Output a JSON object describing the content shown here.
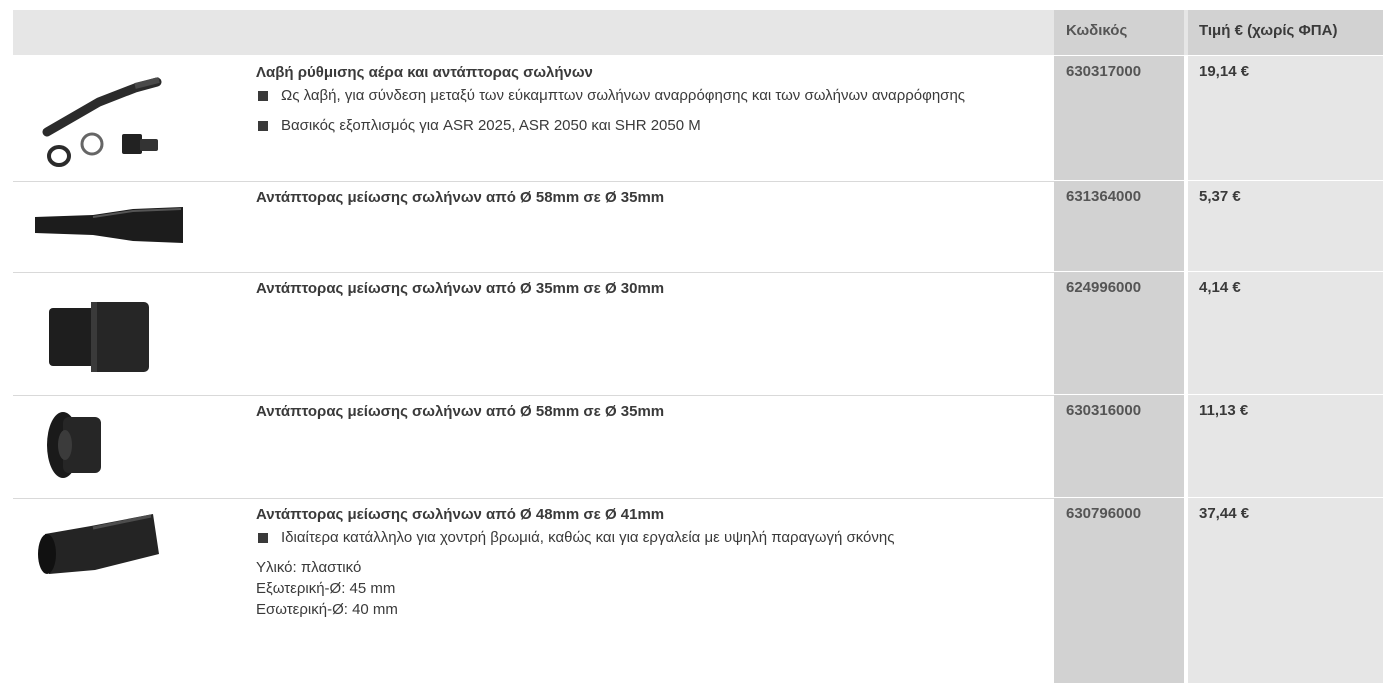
{
  "header": {
    "code_label": "Κωδικός",
    "price_label": "Τιμή € (χωρίς ΦΠΑ)"
  },
  "rows": [
    {
      "image": "handle-adapter-icon",
      "title": "Λαβή ρύθμισης αέρα και αντάπτορας σωλήνων",
      "bullets": [
        "Ως λαβή, για σύνδεση μεταξύ των εύκαμπτων σωλήνων  αναρρόφησης και των σωλήνων αναρρόφησης",
        "Βασικός εξοπλισμός για ASR 2025, ASR 2050 και SHR 2050 M"
      ],
      "code": "630317000",
      "price": "19,14 €"
    },
    {
      "image": "reducer-tube-icon",
      "title": "Αντάπτορας μείωσης σωλήνων από Ø 58mm σε Ø 35mm",
      "code": "631364000",
      "price": "5,37 €"
    },
    {
      "image": "reducer-sleeve-icon",
      "title": "Αντάπτορας μείωσης σωλήνων από Ø 35mm σε Ø 30mm",
      "code": "624996000",
      "price": "4,14 €"
    },
    {
      "image": "reducer-ring-icon",
      "title": "Αντάπτορας μείωσης σωλήνων από Ø 58mm σε Ø 35mm",
      "code": "630316000",
      "price": "11,13 €"
    },
    {
      "image": "reducer-coupler-icon",
      "title": "Αντάπτορας μείωσης σωλήνων από Ø 48mm σε Ø 41mm",
      "bullets": [
        "Ιδιαίτερα κατάλληλο για χοντρή βρωμιά, καθώς και για εργαλεία με υψηλή παραγωγή σκόνης"
      ],
      "extra": [
        "Υλικό: πλαστικό",
        "Εξωτερική-Ø: 45 mm",
        "Εσωτερική-Ø: 40 mm"
      ],
      "code": "630796000",
      "price": "37,44 €"
    }
  ]
}
